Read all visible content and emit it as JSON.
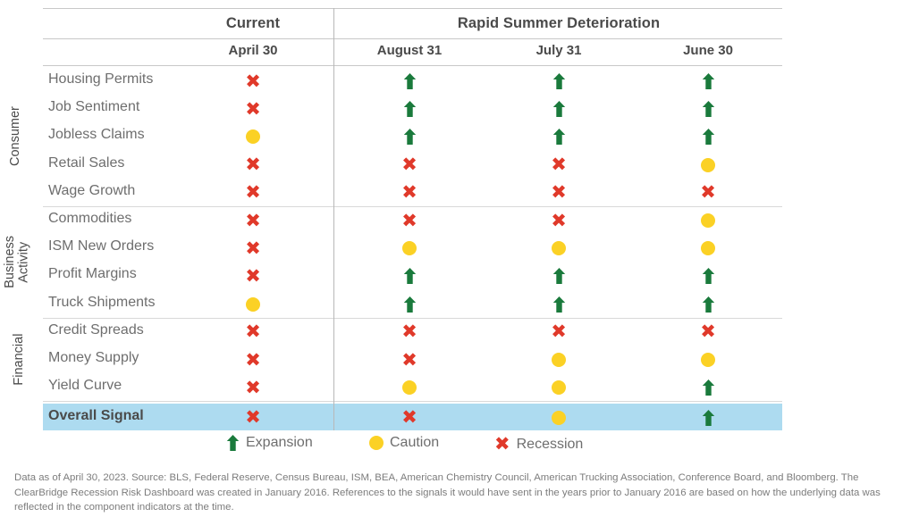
{
  "title": "ClearBridge Recession Risk Dashboard",
  "colors": {
    "expansion_green": "#1a7a3c",
    "caution_yellow": "#fbd125",
    "recession_red": "#e0392a",
    "highlight_blue": "#addbf0",
    "rule_gray": "#c8c8c8",
    "text_gray": "#6e6e6e"
  },
  "header": {
    "groups": [
      {
        "label": "Current",
        "span": 1
      },
      {
        "label": "Rapid Summer Deterioration",
        "span": 3
      }
    ],
    "dates": [
      "April 30",
      "August 31",
      "July 31",
      "June 30"
    ]
  },
  "categories": [
    {
      "name": "Consumer",
      "rows": [
        0,
        1,
        2,
        3,
        4
      ]
    },
    {
      "name": "Business\nActivity",
      "rows": [
        5,
        6,
        7,
        8
      ]
    },
    {
      "name": "Financial",
      "rows": [
        9,
        10,
        11
      ]
    }
  ],
  "rows": [
    {
      "label": "Housing Permits",
      "values": [
        "recession",
        "expansion",
        "expansion",
        "expansion"
      ]
    },
    {
      "label": "Job Sentiment",
      "values": [
        "recession",
        "expansion",
        "expansion",
        "expansion"
      ]
    },
    {
      "label": "Jobless Claims",
      "values": [
        "caution",
        "expansion",
        "expansion",
        "expansion"
      ]
    },
    {
      "label": "Retail Sales",
      "values": [
        "recession",
        "recession",
        "recession",
        "caution"
      ]
    },
    {
      "label": "Wage Growth",
      "values": [
        "recession",
        "recession",
        "recession",
        "recession"
      ]
    },
    {
      "label": "Commodities",
      "values": [
        "recession",
        "recession",
        "recession",
        "caution"
      ]
    },
    {
      "label": "ISM New Orders",
      "values": [
        "recession",
        "caution",
        "caution",
        "caution"
      ]
    },
    {
      "label": "Profit Margins",
      "values": [
        "recession",
        "expansion",
        "expansion",
        "expansion"
      ]
    },
    {
      "label": "Truck Shipments",
      "values": [
        "caution",
        "expansion",
        "expansion",
        "expansion"
      ]
    },
    {
      "label": "Credit Spreads",
      "values": [
        "recession",
        "recession",
        "recession",
        "recession"
      ]
    },
    {
      "label": "Money Supply",
      "values": [
        "recession",
        "recession",
        "caution",
        "caution"
      ]
    },
    {
      "label": "Yield Curve",
      "values": [
        "recession",
        "caution",
        "caution",
        "expansion"
      ]
    }
  ],
  "overall": {
    "label": "Overall Signal",
    "values": [
      "recession",
      "recession",
      "caution",
      "expansion"
    ]
  },
  "legend": [
    {
      "symbol": "expansion",
      "label": "Expansion"
    },
    {
      "symbol": "caution",
      "label": "Caution"
    },
    {
      "symbol": "recession",
      "label": "Recession"
    }
  ],
  "footnote": "Data as of April 30, 2023. Source: BLS, Federal Reserve, Census Bureau, ISM, BEA, American Chemistry Council, American Trucking Association, Conference Board, and Bloomberg. The ClearBridge Recession Risk Dashboard was created in January 2016. References to the signals it would have sent in the years prior to January 2016 are based on how the underlying data was reflected in the component indicators at the time."
}
